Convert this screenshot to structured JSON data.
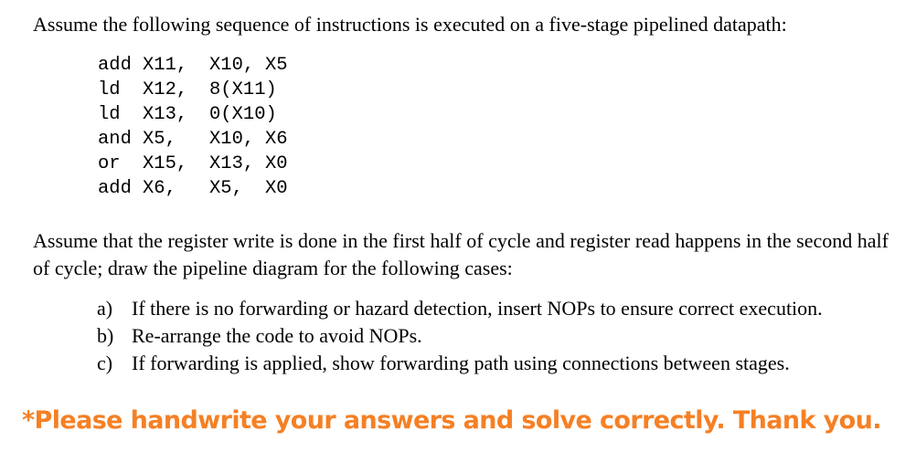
{
  "intro": "Assume the following sequence of instructions is executed on a five-stage pipelined datapath:",
  "instructions": [
    {
      "op": "add",
      "a1": "X11,",
      "a2": "X10,",
      "a3": "X5"
    },
    {
      "op": "ld",
      "a1": "X12,",
      "a2": "8(X11)",
      "a3": ""
    },
    {
      "op": "ld",
      "a1": "X13,",
      "a2": "0(X10)",
      "a3": ""
    },
    {
      "op": "and",
      "a1": "X5,",
      "a2": "X10,",
      "a3": "X6"
    },
    {
      "op": "or",
      "a1": "X15,",
      "a2": "X13,",
      "a3": "X0"
    },
    {
      "op": "add",
      "a1": "X6,",
      "a2": "X5,",
      "a3": "X0"
    }
  ],
  "paragraph": "Assume that the register write is done in the first half of cycle and register read happens in the second half of cycle; draw the pipeline diagram for the following cases:",
  "cases": [
    {
      "marker": "a)",
      "text": "If there is no forwarding or hazard detection, insert NOPs to ensure correct execution."
    },
    {
      "marker": "b)",
      "text": "Re-arrange the code to avoid NOPs."
    },
    {
      "marker": "c)",
      "text": "If forwarding is applied, show forwarding path using connections between stages."
    }
  ],
  "note": "*Please handwrite your answers and solve correctly. Thank you.",
  "colors": {
    "note": "#f58025",
    "text": "#000000"
  }
}
